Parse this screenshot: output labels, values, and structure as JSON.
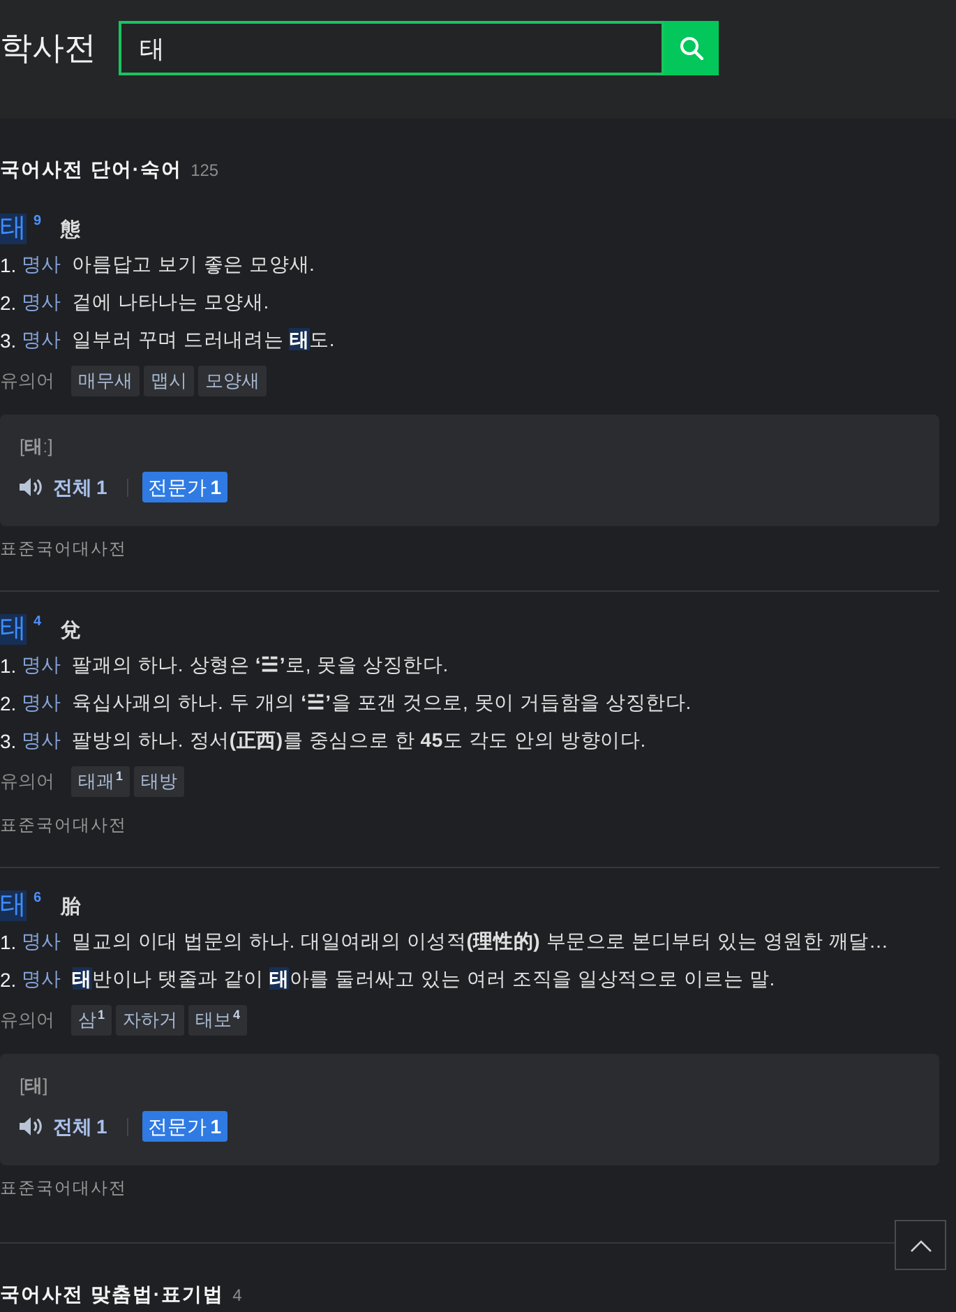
{
  "header": {
    "logo": "학사전",
    "search": {
      "value": "태"
    }
  },
  "sections": [
    {
      "title": "국어사전 단어·숙어",
      "count": "125",
      "entries": [
        {
          "headword": "태",
          "homonym": "9",
          "hanja": "態",
          "definitions": [
            {
              "number": "1.",
              "pos": "명사",
              "parts": [
                {
                  "kind": "plain",
                  "text": "아름답고 보기 좋은 모양새."
                }
              ]
            },
            {
              "number": "2.",
              "pos": "명사",
              "parts": [
                {
                  "kind": "plain",
                  "text": "겉에 나타나는 모양새."
                }
              ]
            },
            {
              "number": "3.",
              "pos": "명사",
              "parts": [
                {
                  "kind": "plain",
                  "text": "일부러 꾸며 드러내려는 "
                },
                {
                  "kind": "match",
                  "text": "태"
                },
                {
                  "kind": "plain",
                  "text": "도."
                }
              ]
            }
          ],
          "synonyms_label": "유의어",
          "synonyms": [
            {
              "word": "매무새"
            },
            {
              "word": "맵시"
            },
            {
              "word": "모양새"
            }
          ],
          "pronunciation": {
            "text": "[**태**ː]",
            "filters": [
              {
                "label": "전체",
                "count": "1",
                "selected": false
              },
              {
                "label": "전문가",
                "count": "1",
                "selected": true
              }
            ]
          },
          "source": "표준국어대사전"
        },
        {
          "headword": "태",
          "homonym": "4",
          "hanja": "兌",
          "definitions": [
            {
              "number": "1.",
              "pos": "명사",
              "parts": [
                {
                  "kind": "plain",
                  "text": "팔괘의 하나. 상형은 **‘☱’**로, 못을 상징한다."
                }
              ]
            },
            {
              "number": "2.",
              "pos": "명사",
              "parts": [
                {
                  "kind": "plain",
                  "text": "육십사괘의 하나. 두 개의 **‘☱’**을 포갠 것으로, 못이 거듭함을 상징한다."
                }
              ]
            },
            {
              "number": "3.",
              "pos": "명사",
              "parts": [
                {
                  "kind": "plain",
                  "text": "팔방의 하나. 정서**(正西)**를 중심으로 한 **45**도 각도 안의 방향이다."
                }
              ]
            }
          ],
          "synonyms_label": "유의어",
          "synonyms": [
            {
              "word": "태괘",
              "sup": "1"
            },
            {
              "word": "태방"
            }
          ],
          "source": "표준국어대사전"
        },
        {
          "headword": "태",
          "homonym": "6",
          "hanja": "胎",
          "definitions": [
            {
              "number": "1.",
              "pos": "명사",
              "parts": [
                {
                  "kind": "plain",
                  "text": "밀교의 이대 법문의 하나. 대일여래의 이성적**(理性的)** 부문으로 본디부터 있는 영원한 깨달…"
                }
              ]
            },
            {
              "number": "2.",
              "pos": "명사",
              "parts": [
                {
                  "kind": "match",
                  "text": "태"
                },
                {
                  "kind": "plain",
                  "text": "반이나 탯줄과 같이 "
                },
                {
                  "kind": "match",
                  "text": "태"
                },
                {
                  "kind": "plain",
                  "text": "아를 둘러싸고 있는 여러 조직을 일상적으로 이르는 말."
                }
              ]
            }
          ],
          "synonyms_label": "유의어",
          "synonyms": [
            {
              "word": "삼",
              "sup": "1"
            },
            {
              "word": "자하거"
            },
            {
              "word": "태보",
              "sup": "4"
            }
          ],
          "pronunciation": {
            "text": "[**태**]",
            "filters": [
              {
                "label": "전체",
                "count": "1",
                "selected": false
              },
              {
                "label": "전문가",
                "count": "1",
                "selected": true
              }
            ]
          },
          "source": "표준국어대사전"
        }
      ]
    },
    {
      "title": "국어사전 맞춤법·표기법",
      "count": "4"
    }
  ]
}
